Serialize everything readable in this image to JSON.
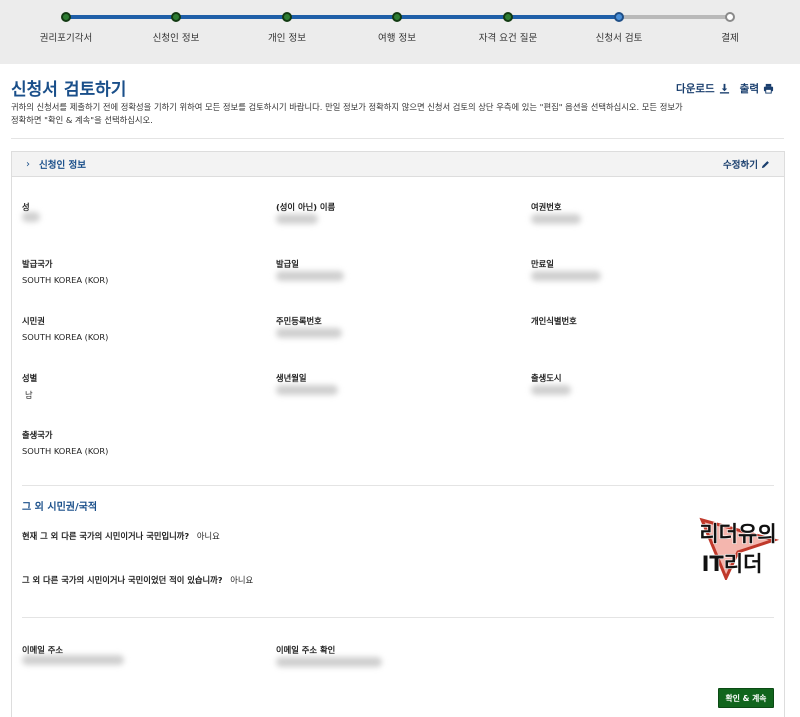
{
  "steps": [
    {
      "label": "권리포기각서",
      "state": "complete"
    },
    {
      "label": "신청인 정보",
      "state": "complete"
    },
    {
      "label": "개인 정보",
      "state": "complete"
    },
    {
      "label": "여행 정보",
      "state": "complete"
    },
    {
      "label": "자격 요건 질문",
      "state": "complete"
    },
    {
      "label": "신청서 검토",
      "state": "current"
    },
    {
      "label": "결제",
      "state": "pending"
    }
  ],
  "header": {
    "title": "신청서 검토하기",
    "download_label": "다운로드",
    "print_label": "출력",
    "intro": "귀하의 신청서를 제출하기 전에 정확성을 기하기 위하여 모든 정보를 검토하시기 바랍니다. 만일 정보가 정확하지 않으면 신청서 검토의 상단 우측에 있는 \"편집\" 옵션을 선택하십시오. 모든 정보가 정확하면 \"확인 & 계속\"을 선택하십시오."
  },
  "section": {
    "title": "신청인 정보",
    "edit_label": "수정하기",
    "fields": {
      "surname": {
        "label": "성",
        "value": ""
      },
      "given_name": {
        "label": "(성이 아닌) 이름",
        "value": ""
      },
      "passport_no": {
        "label": "여권번호",
        "value": ""
      },
      "issuing_country": {
        "label": "발급국가",
        "value": "SOUTH KOREA (KOR)"
      },
      "issue_date": {
        "label": "발급일",
        "value": ""
      },
      "expiry_date": {
        "label": "만료일",
        "value": ""
      },
      "citizenship": {
        "label": "시민권",
        "value": "SOUTH KOREA (KOR)"
      },
      "resident_no": {
        "label": "주민등록번호",
        "value": ""
      },
      "personal_id": {
        "label": "개인식별번호",
        "value": ""
      },
      "sex": {
        "label": "성별",
        "value": "남"
      },
      "birth_date": {
        "label": "생년월일",
        "value": ""
      },
      "birth_city": {
        "label": "출생도시",
        "value": ""
      },
      "birth_country": {
        "label": "출생국가",
        "value": "SOUTH KOREA (KOR)"
      },
      "email": {
        "label": "이메일 주소",
        "value": ""
      },
      "email_confirm": {
        "label": "이메일 주소 확인",
        "value": ""
      }
    },
    "other_citizenship": {
      "heading": "그 외 시민권/국적",
      "q1": "현재 그 외 다른 국가의 시민이거나 국민입니까?",
      "a1": "아니요",
      "q2": "그 외 다른 국가의 시민이거나 국민이었던 적이 있습니까?",
      "a2": "아니요"
    },
    "watermark": {
      "line1": "리더유의",
      "line2": "IT리더"
    }
  },
  "footer": {
    "confirm_label": "확인 & 계속"
  },
  "colors": {
    "accent": "#1a4f8a",
    "progress": "#1f5fa8",
    "complete": "#2e7d32",
    "button": "#11651d"
  }
}
